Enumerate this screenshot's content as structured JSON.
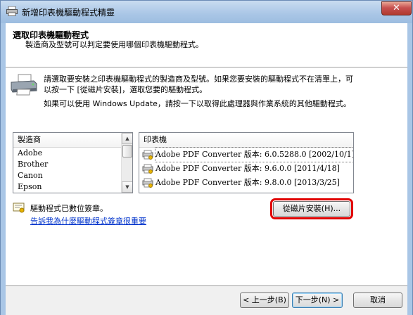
{
  "window": {
    "title": "新增印表機驅動程式精靈",
    "close_symbol": "✕"
  },
  "header": {
    "title": "選取印表機驅動程式",
    "subtitle": "製造商及型號可以判定要使用哪個印表機驅動程式。"
  },
  "info": {
    "paragraph1": "請選取要安裝之印表機驅動程式的製造商及型號。如果您要安裝的驅動程式不在清單上，可以按一下 [從磁片安裝]，選取您要的驅動程式。",
    "paragraph2": "如果可以使用 Windows Update，請按一下以取得此處理器與作業系統的其他驅動程式。"
  },
  "manufacturers": {
    "header": "製造商",
    "items": [
      "Adobe",
      "Brother",
      "Canon",
      "Epson"
    ]
  },
  "printers": {
    "header": "印表機",
    "items": [
      "Adobe PDF Converter 版本: 6.0.5288.0 [2002/10/1]",
      "Adobe PDF Converter 版本: 9.6.0.0 [2011/4/18]",
      "Adobe PDF Converter 版本: 9.8.0.0 [2013/3/25]"
    ]
  },
  "signature": {
    "text": "驅動程式已數位簽章。",
    "link": "告訴我為什麼驅動程式簽章很重要"
  },
  "buttons": {
    "have_disk": "從磁片安裝(H)...",
    "back": "< 上一步(B)",
    "next": "下一步(N) >",
    "cancel": "取消"
  },
  "colors": {
    "highlight": "#e10000",
    "link": "#0033cc"
  }
}
